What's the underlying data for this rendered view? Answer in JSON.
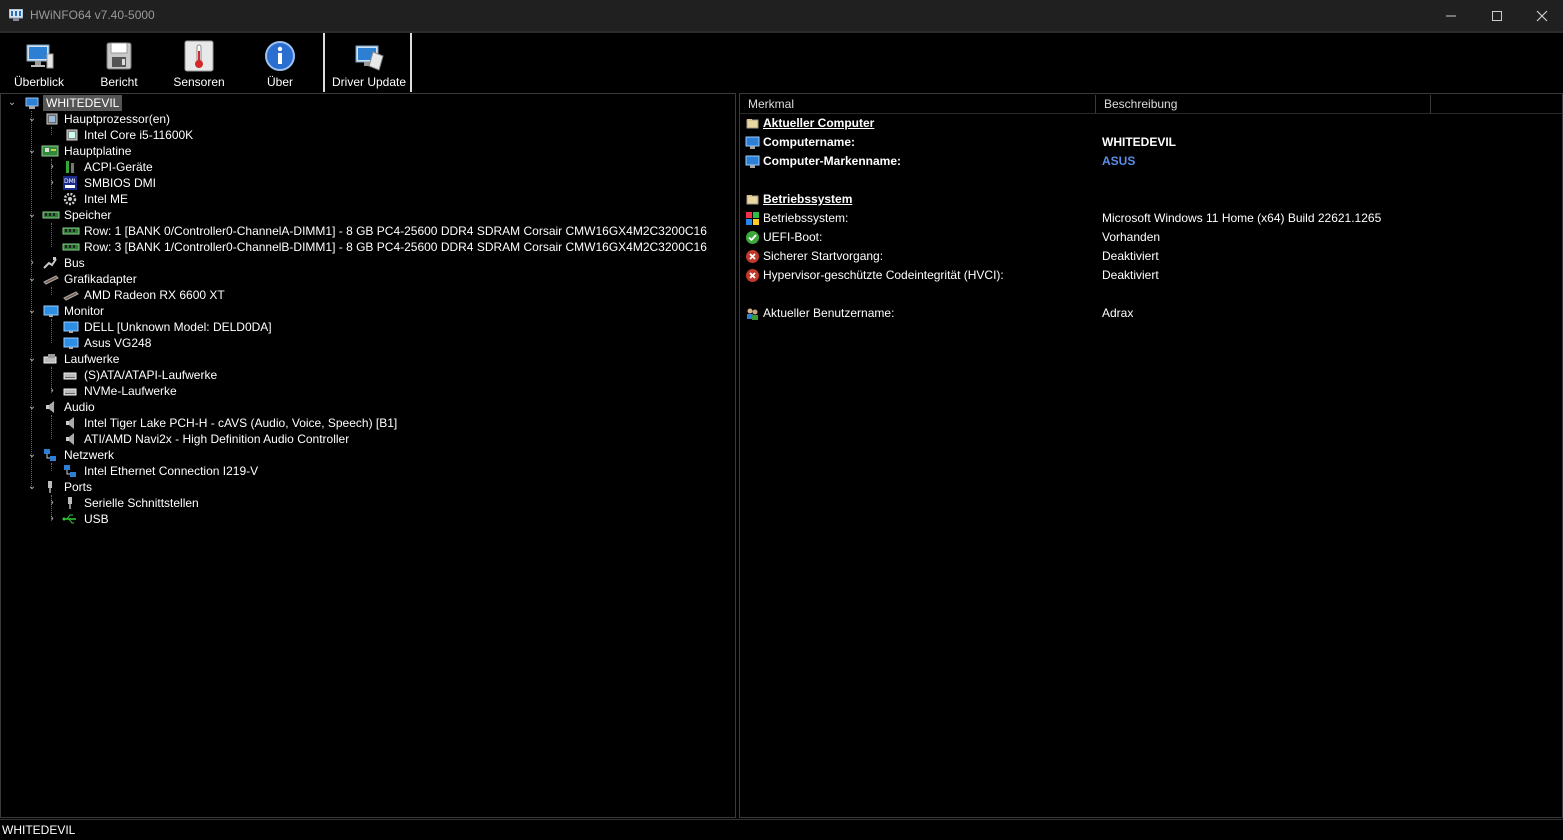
{
  "window": {
    "title": "HWiNFO64 v7.40-5000"
  },
  "toolbar": {
    "overview": "Überblick",
    "report": "Bericht",
    "sensors": "Sensoren",
    "about": "Über",
    "driver_update": "Driver Update"
  },
  "tree": {
    "root": "WHITEDEVIL",
    "cpu": "Hauptprozessor(en)",
    "cpu_item": "Intel Core i5-11600K",
    "mainboard": "Hauptplatine",
    "acpi": "ACPI-Geräte",
    "smbios": "SMBIOS DMI",
    "intel_me": "Intel ME",
    "memory": "Speicher",
    "mem_row1": "Row: 1 [BANK 0/Controller0-ChannelA-DIMM1] - 8 GB PC4-25600 DDR4 SDRAM Corsair CMW16GX4M2C3200C16",
    "mem_row3": "Row: 3 [BANK 1/Controller0-ChannelB-DIMM1] - 8 GB PC4-25600 DDR4 SDRAM Corsair CMW16GX4M2C3200C16",
    "bus": "Bus",
    "gpu": "Grafikadapter",
    "gpu_item": "AMD Radeon RX 6600 XT",
    "monitor": "Monitor",
    "monitor1": "DELL [Unknown Model: DELD0DA]",
    "monitor2": "Asus VG248",
    "drives": "Laufwerke",
    "sata": "(S)ATA/ATAPI-Laufwerke",
    "nvme": "NVMe-Laufwerke",
    "audio": "Audio",
    "audio1": "Intel Tiger Lake PCH-H - cAVS (Audio, Voice, Speech) [B1]",
    "audio2": "ATI/AMD Navi2x - High Definition Audio Controller",
    "network": "Netzwerk",
    "net1": "Intel Ethernet Connection I219-V",
    "ports": "Ports",
    "serial": "Serielle Schnittstellen",
    "usb": "USB"
  },
  "details": {
    "col_feature": "Merkmal",
    "col_description": "Beschreibung",
    "sec_computer": "Aktueller Computer",
    "computer_name_label": "Computername:",
    "computer_name_value": "WHITEDEVIL",
    "brand_label": "Computer-Markenname:",
    "brand_value": "ASUS",
    "sec_os": "Betriebssystem",
    "os_label": "Betriebssystem:",
    "os_value": "Microsoft Windows 11 Home (x64) Build 22621.1265",
    "uefi_label": "UEFI-Boot:",
    "uefi_value": "Vorhanden",
    "secure_label": "Sicherer Startvorgang:",
    "secure_value": "Deaktiviert",
    "hvci_label": "Hypervisor-geschützte Codeintegrität (HVCI):",
    "hvci_value": "Deaktiviert",
    "user_label": "Aktueller Benutzername:",
    "user_value": "Adrax"
  },
  "status": {
    "text": "WHITEDEVIL"
  },
  "colors": {
    "link_blue": "#5b8ee6",
    "accent_red": "#c0392b"
  }
}
